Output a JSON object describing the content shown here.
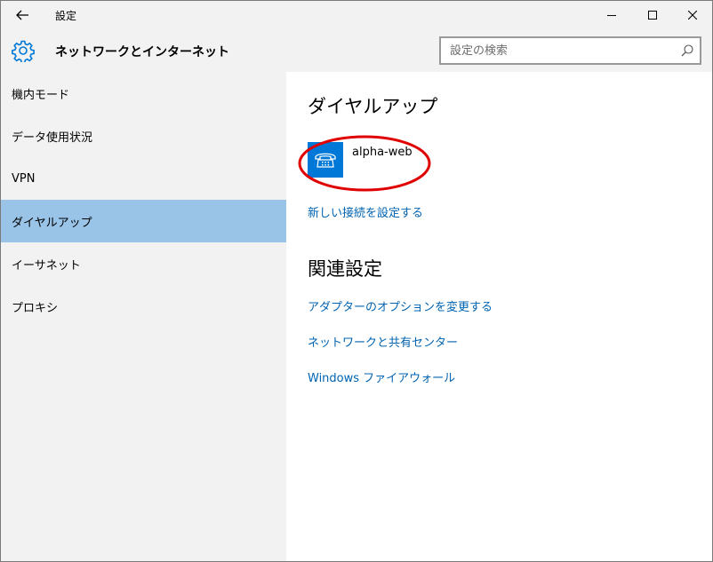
{
  "window": {
    "title": "設定"
  },
  "header": {
    "title": "ネットワークとインターネット",
    "search_placeholder": "設定の検索"
  },
  "sidebar": {
    "items": [
      {
        "label": "機内モード",
        "selected": false
      },
      {
        "label": "データ使用状況",
        "selected": false
      },
      {
        "label": "VPN",
        "selected": false
      },
      {
        "label": "ダイヤルアップ",
        "selected": true
      },
      {
        "label": "イーサネット",
        "selected": false
      },
      {
        "label": "プロキシ",
        "selected": false
      }
    ]
  },
  "main": {
    "section_title": "ダイヤルアップ",
    "connection": {
      "name": "alpha-web",
      "icon": "phone-icon"
    },
    "new_connection_link": "新しい接続を設定する",
    "related_title": "関連設定",
    "related_links": [
      "アダプターのオプションを変更する",
      "ネットワークと共有センター",
      "Windows ファイアウォール"
    ]
  },
  "colors": {
    "accent": "#0078d7",
    "link": "#0063b1",
    "selected_bg": "#99c4e8",
    "chrome_bg": "#f2f2f2",
    "annotation": "#e00000"
  }
}
